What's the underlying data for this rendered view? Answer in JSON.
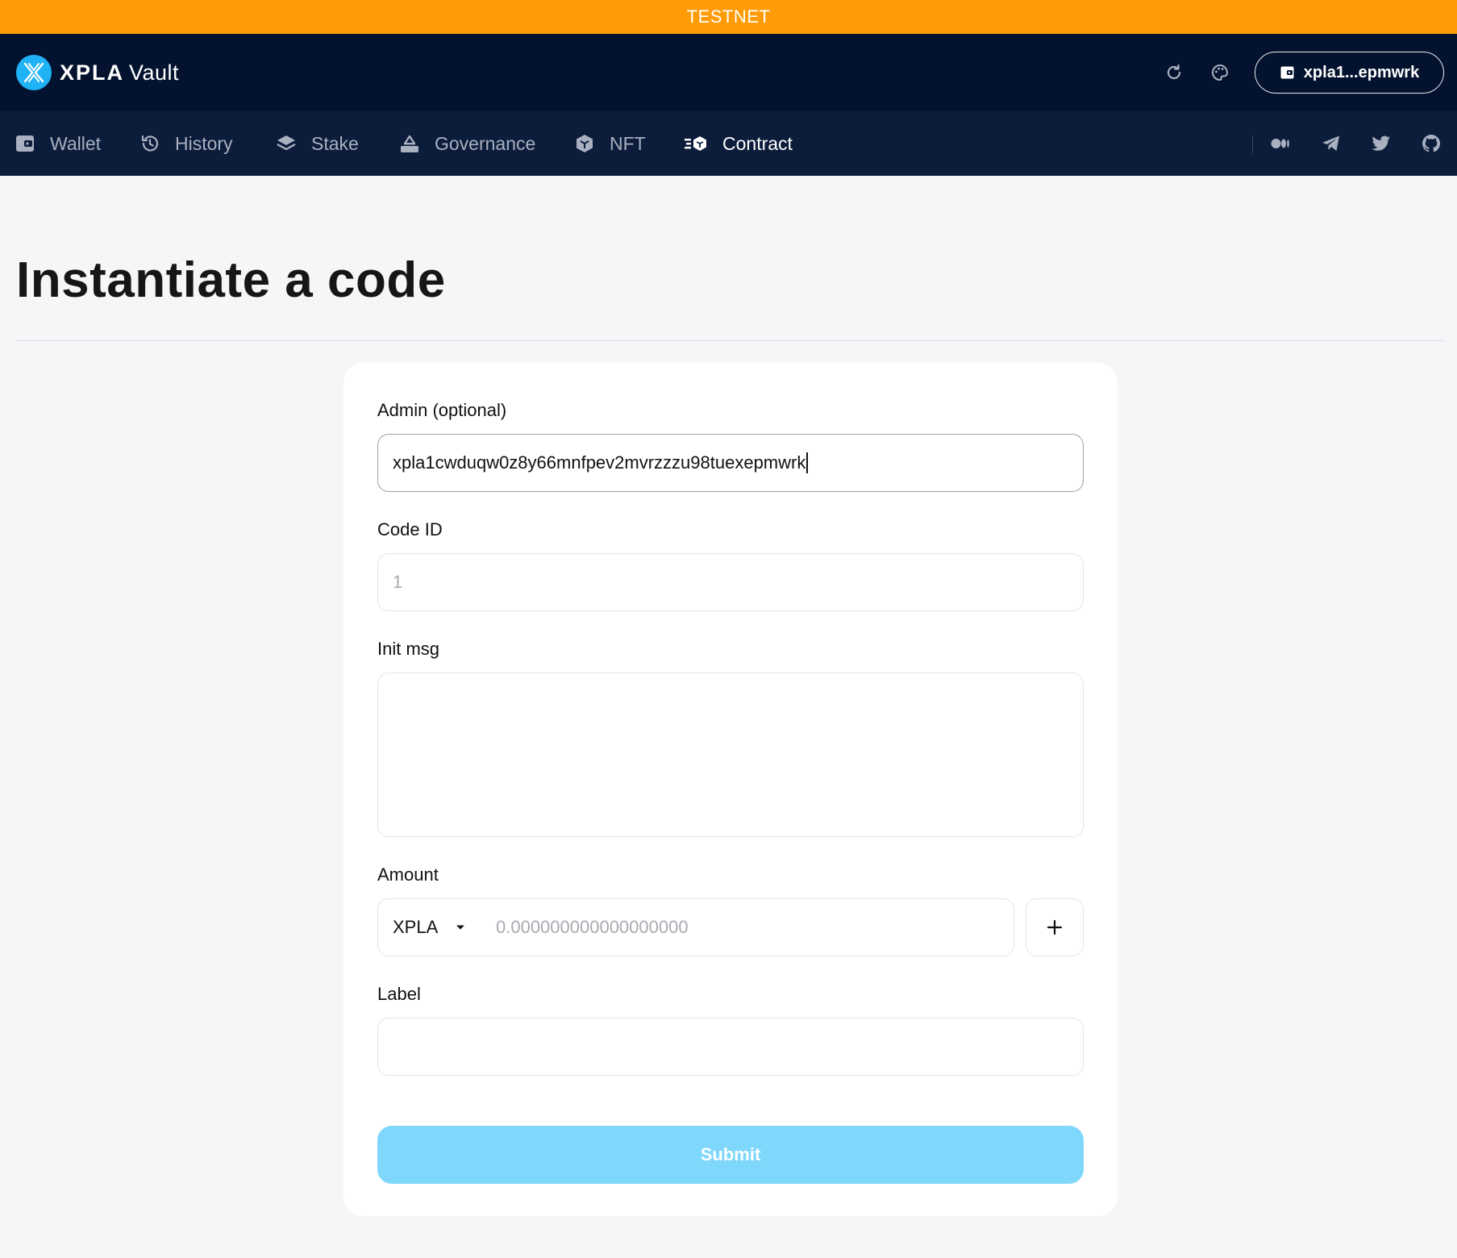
{
  "banner": {
    "text": "TESTNET",
    "color": "#ff9b06"
  },
  "header": {
    "brand": "XPLA",
    "product": "Vault",
    "refresh_icon": "refresh-icon",
    "theme_icon": "palette-icon",
    "wallet_label": "xpla1...epmwrk"
  },
  "nav": {
    "items": [
      {
        "label": "Wallet",
        "icon": "wallet-icon"
      },
      {
        "label": "History",
        "icon": "history-icon"
      },
      {
        "label": "Stake",
        "icon": "layers-icon"
      },
      {
        "label": "Governance",
        "icon": "ballot-icon"
      },
      {
        "label": "NFT",
        "icon": "cube-icon"
      },
      {
        "label": "Contract",
        "icon": "contract-icon",
        "active": true
      }
    ],
    "social": [
      "medium-icon",
      "telegram-icon",
      "twitter-icon",
      "github-icon"
    ]
  },
  "page": {
    "title": "Instantiate a code"
  },
  "form": {
    "admin": {
      "label": "Admin (optional)",
      "value": "xpla1cwduqw0z8y66mnfpev2mvrzzzu98tuexepmwrk"
    },
    "code_id": {
      "label": "Code ID",
      "placeholder": "1"
    },
    "init_msg": {
      "label": "Init msg",
      "value": ""
    },
    "amount": {
      "label": "Amount",
      "denom": "XPLA",
      "placeholder": "0.000000000000000000"
    },
    "label": {
      "label": "Label",
      "value": ""
    },
    "submit_label": "Submit"
  },
  "colors": {
    "header_bg": "#03122e",
    "nav_bg": "#0c1c3b",
    "accent": "#1fb3f5",
    "submit_bg": "#7fd7fc"
  }
}
